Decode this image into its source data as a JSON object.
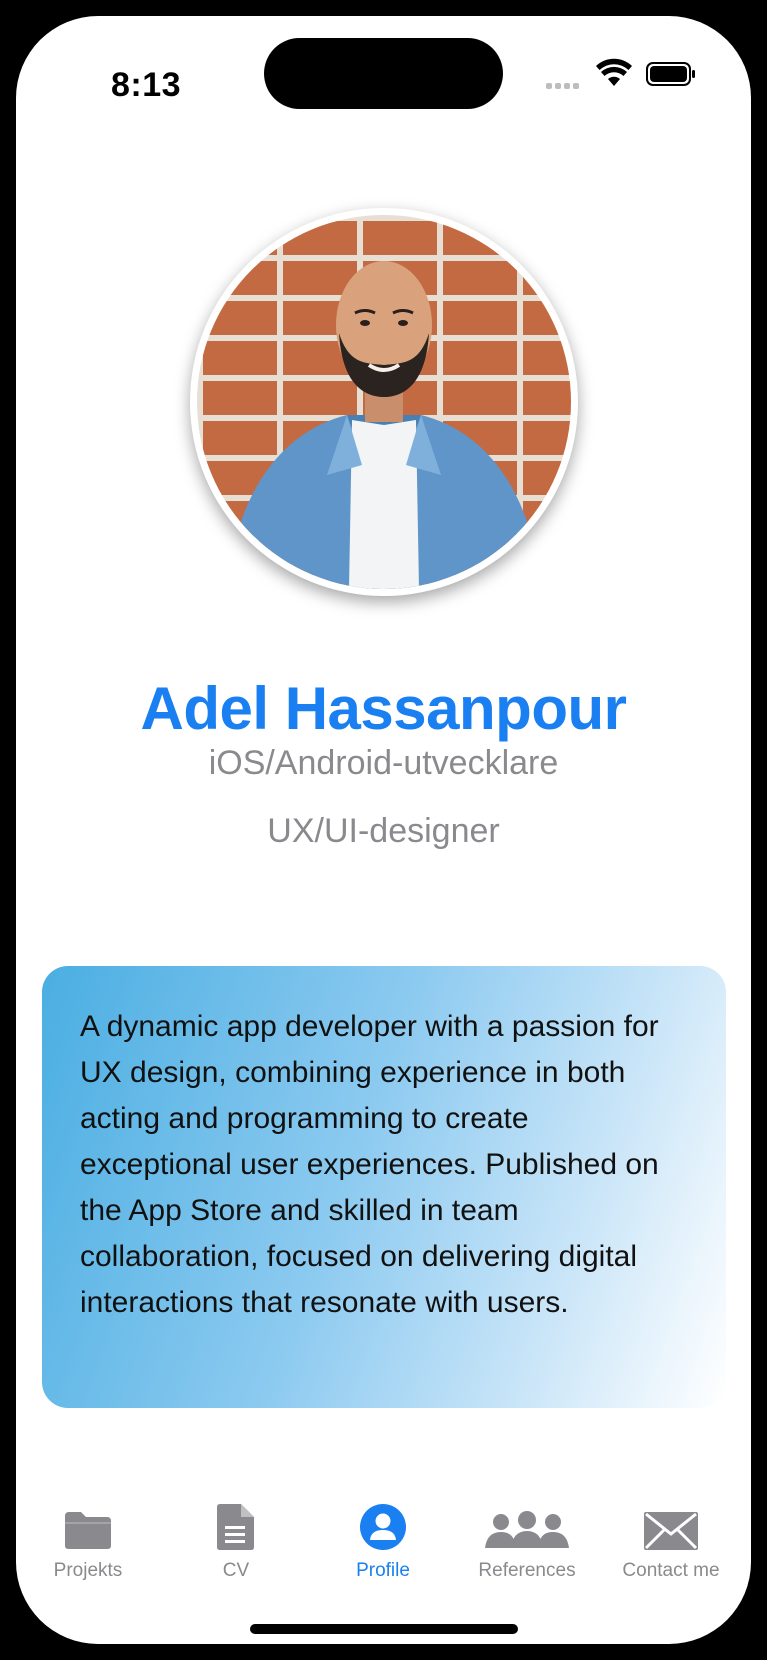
{
  "status_bar": {
    "time": "8:13"
  },
  "profile": {
    "name": "Adel Hassanpour",
    "roles": [
      "iOS/Android-utvecklare",
      "UX/UI-designer"
    ],
    "bio": "A dynamic app developer with a passion for UX design, combining experience in both acting and programming to create exceptional user experiences. Published on the App Store and skilled in team collaboration, focused on delivering digital interactions that resonate with users."
  },
  "tabs": [
    {
      "label": "Projekts",
      "icon": "folder-icon",
      "active": false
    },
    {
      "label": "CV",
      "icon": "document-icon",
      "active": false
    },
    {
      "label": "Profile",
      "icon": "person-circle-icon",
      "active": true
    },
    {
      "label": "References",
      "icon": "people-icon",
      "active": false
    },
    {
      "label": "Contact me",
      "icon": "envelope-icon",
      "active": false
    }
  ],
  "colors": {
    "accent": "#1a7ff0",
    "inactive": "#8a8a8e"
  }
}
